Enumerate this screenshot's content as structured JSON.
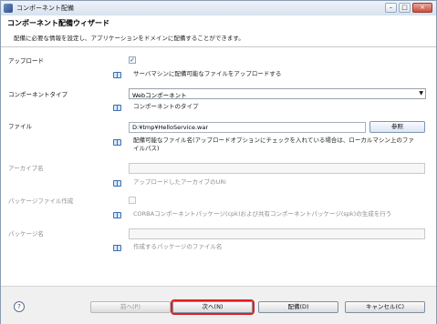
{
  "window": {
    "title": "コンポーネント配備"
  },
  "header": {
    "title": "コンポーネント配備ウィザード",
    "description": "配備に必要な情報を設定し、アプリケーションをドメインに配備することができます。"
  },
  "fields": {
    "upload": {
      "label": "アップロード",
      "checked": true,
      "check_mark": "✓",
      "help": "サーバマシンに配備可能なファイルをアップロードする"
    },
    "component_type": {
      "label": "コンポーネントタイプ",
      "value": "Webコンポーネント",
      "help": "コンポーネントのタイプ"
    },
    "file": {
      "label": "ファイル",
      "value": "D:¥tmp¥HelloService.war",
      "browse_label": "参照",
      "help_line1": "配備可能なファイル名(アップロードオプションにチェックを入れている場合は、ローカルマシン上のファ",
      "help_line2": "イルパス)"
    },
    "archive_name": {
      "label": "アーカイブ名",
      "value": "",
      "help": "アップロードしたアーカイブのURI"
    },
    "package_create": {
      "label": "パッケージファイル作成",
      "checked": false,
      "help": "CORBAコンポーネントパッケージ(cpk)および共有コンポーネントパッケージ(spk)の生成を行う"
    },
    "package_name": {
      "label": "パッケージ名",
      "value": "",
      "help": "作成するパッケージのファイル名"
    }
  },
  "footer": {
    "help_icon": "?",
    "back_label": "前へ(P)",
    "next_label": "次へ(N)",
    "deploy_label": "配備(D)",
    "cancel_label": "キャンセル(C)"
  },
  "colors": {
    "highlight": "#e02020"
  }
}
